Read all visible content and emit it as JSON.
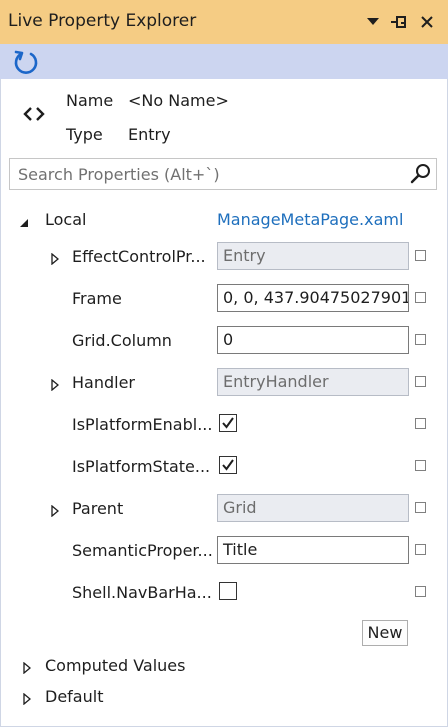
{
  "window": {
    "title": "Live Property Explorer",
    "colors": {
      "titlebar": "#f5cc84",
      "toolbar": "#ccd5f0",
      "link": "#1e6fbd"
    }
  },
  "element_info": {
    "name_label": "Name",
    "name_value": "<No Name>",
    "type_label": "Type",
    "type_value": "Entry"
  },
  "search": {
    "placeholder": "Search Properties (Alt+`)"
  },
  "local": {
    "label": "Local",
    "source_link": "ManageMetaPage.xaml",
    "properties": [
      {
        "name": "EffectControlPr...",
        "value": "Entry",
        "kind": "readonly",
        "expandable": true
      },
      {
        "name": "Frame",
        "value": "0, 0, 437.90475027901",
        "kind": "text",
        "expandable": false
      },
      {
        "name": "Grid.Column",
        "value": "0",
        "kind": "text",
        "expandable": false
      },
      {
        "name": "Handler",
        "value": "EntryHandler",
        "kind": "readonly",
        "expandable": true
      },
      {
        "name": "IsPlatformEnabl...",
        "checked": true,
        "kind": "checkbox",
        "expandable": false
      },
      {
        "name": "IsPlatformState...",
        "checked": true,
        "kind": "checkbox",
        "expandable": false
      },
      {
        "name": "Parent",
        "value": "Grid",
        "kind": "readonly",
        "expandable": true
      },
      {
        "name": "SemanticProper...",
        "value": "Title",
        "kind": "text",
        "expandable": false
      },
      {
        "name": "Shell.NavBarHa...",
        "checked": false,
        "kind": "checkbox",
        "expandable": false
      }
    ],
    "new_button": "New"
  },
  "sections": {
    "computed": "Computed Values",
    "default": "Default"
  }
}
